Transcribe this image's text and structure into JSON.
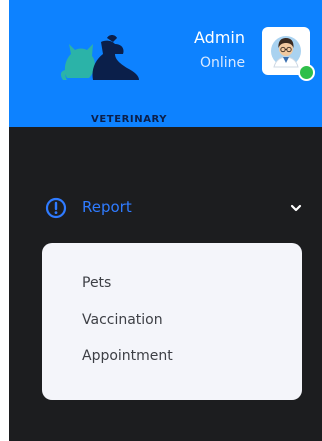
{
  "brand": {
    "logo_text": "VETERINARY"
  },
  "user": {
    "name": "Admin",
    "status": "Online",
    "status_color": "#2fbf4a"
  },
  "menu": {
    "report": {
      "label": "Report",
      "icon": "info-circle-icon",
      "expanded": true,
      "items": [
        {
          "label": "Pets"
        },
        {
          "label": "Vaccination"
        },
        {
          "label": "Appointment"
        }
      ]
    }
  },
  "colors": {
    "header_bg": "#0d82ff",
    "sidebar_bg": "#1c1d1f",
    "accent": "#2f7bff",
    "submenu_bg": "#f4f5fa"
  }
}
